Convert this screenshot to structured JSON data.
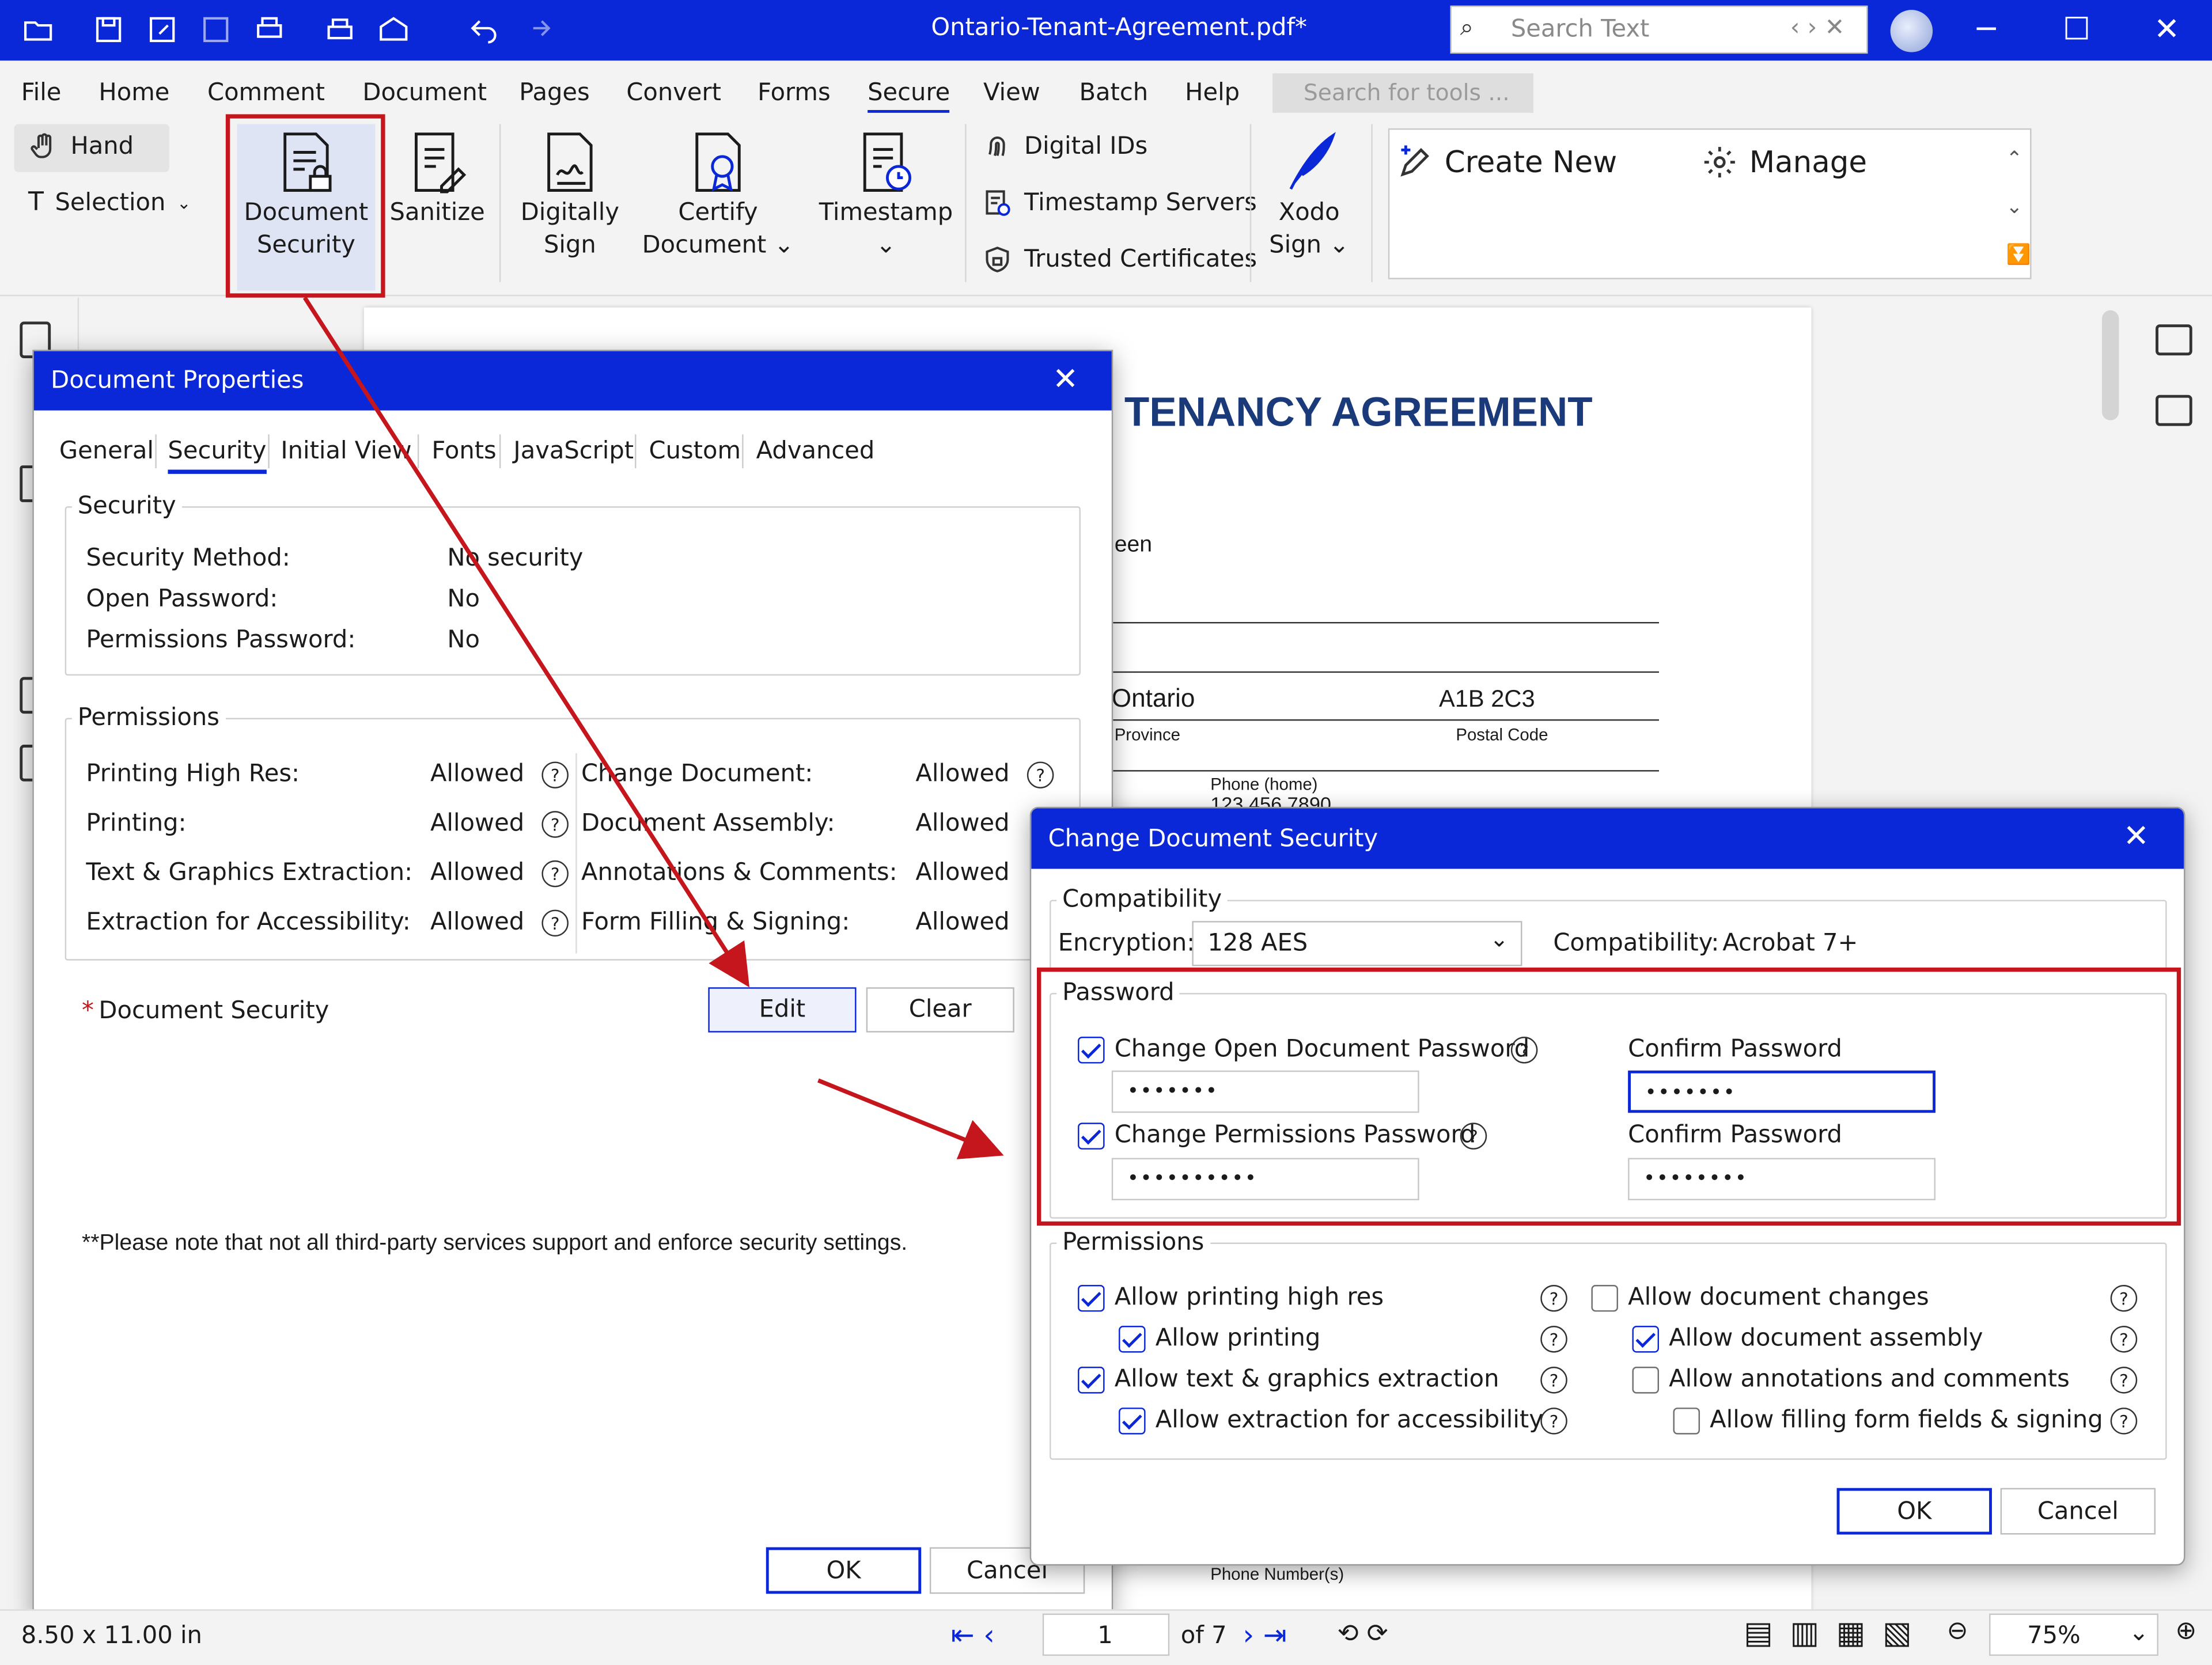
{
  "window": {
    "title": "Ontario-Tenant-Agreement.pdf*",
    "search_placeholder": "Search Text"
  },
  "menu": [
    "File",
    "Home",
    "Comment",
    "Document",
    "Pages",
    "Convert",
    "Forms",
    "Secure",
    "View",
    "Batch",
    "Help"
  ],
  "tools_search": "Search for tools ...",
  "ribbon": {
    "hand": "Hand",
    "selection": "Selection",
    "doc_security_1": "Document",
    "doc_security_2": "Security",
    "sanitize": "Sanitize",
    "digitally_1": "Digitally",
    "digitally_2": "Sign",
    "certify_1": "Certify",
    "certify_2": "Document",
    "timestamp": "Timestamp",
    "digital_ids": "Digital IDs",
    "timestamp_servers": "Timestamp Servers",
    "trusted_certs": "Trusted Certificates",
    "xodo_1": "Xodo",
    "xodo_2": "Sign",
    "create_new": "Create New",
    "manage": "Manage"
  },
  "doc": {
    "heading": "TENANCY AGREEMENT",
    "fragment": "een",
    "province_value": "Ontario",
    "postal_value": "A1B 2C3",
    "province_label": "Province",
    "postal_label": "Postal Code",
    "phone_home_label": "Phone (home)",
    "phone_home_value": "123 456 7890",
    "phone_numbers_label": "Phone Number(s)"
  },
  "doc_props": {
    "title": "Document Properties",
    "tabs": [
      "General",
      "Security",
      "Initial View",
      "Fonts",
      "JavaScript",
      "Custom",
      "Advanced"
    ],
    "security_group": "Security",
    "security_rows": [
      {
        "label": "Security Method:",
        "value": "No security"
      },
      {
        "label": "Open Password:",
        "value": "No"
      },
      {
        "label": "Permissions Password:",
        "value": "No"
      }
    ],
    "permissions_group": "Permissions",
    "perm_left": [
      {
        "label": "Printing High Res:",
        "value": "Allowed"
      },
      {
        "label": "Printing:",
        "value": "Allowed"
      },
      {
        "label": "Text & Graphics Extraction:",
        "value": "Allowed"
      },
      {
        "label": "Extraction for Accessibility:",
        "value": "Allowed"
      }
    ],
    "perm_right": [
      {
        "label": "Change Document:",
        "value": "Allowed"
      },
      {
        "label": "Document Assembly:",
        "value": "Allowed"
      },
      {
        "label": "Annotations & Comments:",
        "value": "Allowed"
      },
      {
        "label": "Form Filling & Signing:",
        "value": "Allowed"
      }
    ],
    "doc_security_label": "Document Security",
    "edit": "Edit",
    "clear": "Clear",
    "note": "**Please note that not all third-party services support and enforce security settings.",
    "ok": "OK",
    "cancel": "Cancel"
  },
  "cds": {
    "title": "Change Document Security",
    "compat_group": "Compatibility",
    "encryption_label": "Encryption:",
    "encryption_value": "128 AES",
    "compat_label": "Compatibility:",
    "compat_value": "Acrobat 7+",
    "password_group": "Password",
    "open_pwd_label": "Change Open Document Password",
    "open_pwd_checked": true,
    "open_pwd": "•••••••",
    "confirm_label": "Confirm Password",
    "open_confirm": "•••••••",
    "perm_pwd_label": "Change Permissions Password",
    "perm_pwd_checked": true,
    "perm_pwd": "••••••••••",
    "perm_confirm": "••••••••",
    "permissions_group": "Permissions",
    "perms": [
      {
        "label": "Allow printing high res",
        "checked": true
      },
      {
        "label": "Allow printing",
        "checked": true
      },
      {
        "label": "Allow text & graphics extraction",
        "checked": true
      },
      {
        "label": "Allow extraction for accessibility",
        "checked": true
      },
      {
        "label": "Allow document changes",
        "checked": false
      },
      {
        "label": "Allow document assembly",
        "checked": true
      },
      {
        "label": "Allow annotations and comments",
        "checked": false
      },
      {
        "label": "Allow filling form fields & signing",
        "checked": false
      }
    ],
    "ok": "OK",
    "cancel": "Cancel"
  },
  "status": {
    "page_size": "8.50 x 11.00 in",
    "page": "1",
    "of": "of 7",
    "zoom": "75%"
  },
  "colors": {
    "accent": "#0a27d8",
    "highlight": "#c4161c"
  }
}
